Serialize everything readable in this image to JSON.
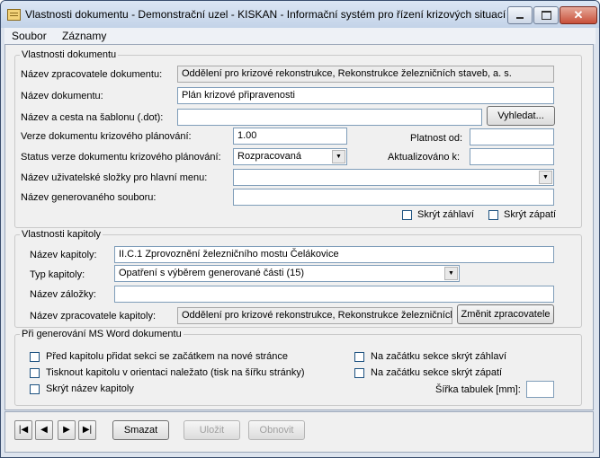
{
  "window": {
    "title": "Vlastnosti dokumentu - Demonstrační uzel - KISKAN - Informační systém pro řízení krizových situací",
    "close_glyph": "✕"
  },
  "menu": [
    "Soubor",
    "Záznamy"
  ],
  "doc": {
    "legend": "Vlastnosti dokumentu",
    "processor_label": "Název zpracovatele dokumentu:",
    "processor_value": "Oddělení pro krizové rekonstrukce, Rekonstrukce železničních staveb, a. s.",
    "name_label": "Název dokumentu:",
    "name_value": "Plán krizové připravenosti",
    "template_label": "Název a cesta na šablonu (.dot):",
    "template_value": "",
    "browse_button": "Vyhledat...",
    "version_label": "Verze dokumentu krizového plánování:",
    "version_value": "1.00",
    "valid_from_label": "Platnost od:",
    "valid_from_value": "",
    "status_label": "Status verze dokumentu krizového plánování:",
    "status_value": "Rozpracovaná",
    "updated_label": "Aktualizováno k:",
    "updated_value": "",
    "folder_label": "Název uživatelské složky pro hlavní menu:",
    "folder_value": "",
    "generated_label": "Název generovaného souboru:",
    "generated_value": "",
    "hide_header": "Skrýt záhlaví",
    "hide_footer": "Skrýt zápatí"
  },
  "chapter": {
    "legend": "Vlastnosti kapitoly",
    "name_label": "Název kapitoly:",
    "name_value": "II.C.1 Zprovoznění železničního mostu Čelákovice",
    "type_label": "Typ kapitoly:",
    "type_value": "Opatření s výběrem generované části (15)",
    "bookmark_label": "Název záložky:",
    "bookmark_value": "",
    "processor_label": "Název zpracovatele kapitoly:",
    "processor_value": "Oddělení pro krizové rekonstrukce, Rekonstrukce železničních",
    "change_button": "Změnit zpracovatele"
  },
  "word": {
    "legend": "Při generování MS Word dokumentu",
    "opt_new_page": "Před kapitolu přidat sekci se začátkem na nové stránce",
    "opt_landscape": "Tisknout kapitolu v orientaci naležato (tisk na šířku stránky)",
    "opt_hide_name": "Skrýt název kapitoly",
    "opt_hide_header": "Na začátku sekce skrýt záhlaví",
    "opt_hide_footer": "Na začátku sekce skrýt zápatí",
    "table_width_label": "Šířka tabulek [mm]:",
    "table_width_value": ""
  },
  "nav": {
    "first": "|◀",
    "prev": "◀",
    "next": "▶",
    "last": "▶|",
    "delete": "Smazat",
    "save": "Uložit",
    "refresh": "Obnovit"
  }
}
